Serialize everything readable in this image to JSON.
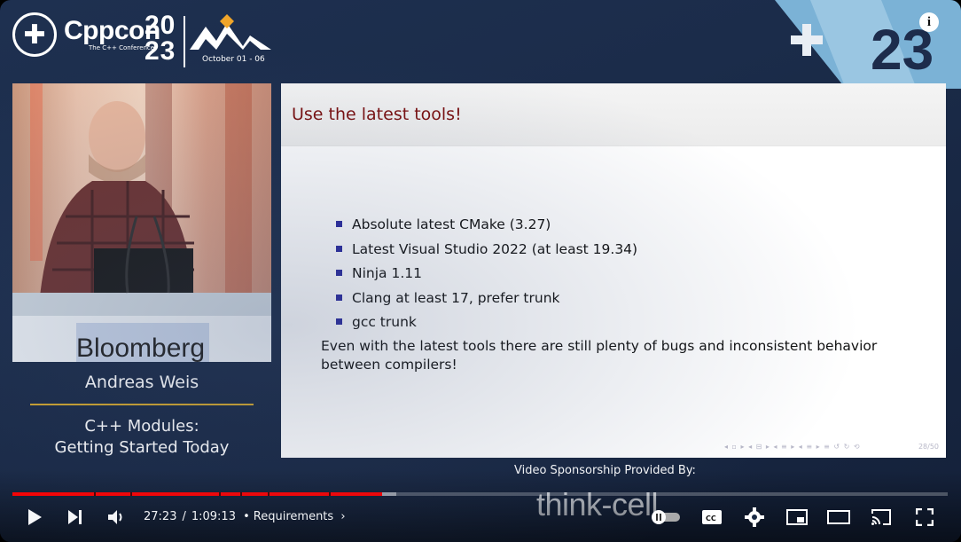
{
  "conference": {
    "logo_name": "Cppcon",
    "logo_sub": "The C++ Conference",
    "year_top": "20",
    "year_bottom": "23",
    "dates": "October 01 - 06",
    "corner_year": "23"
  },
  "speaker": {
    "name": "Andreas Weis",
    "talk_title_line1": "C++ Modules:",
    "talk_title_line2": "Getting Started Today",
    "podium_sponsor": "Bloomberg"
  },
  "slide": {
    "title": "Use the latest tools!",
    "bullets": [
      "Absolute latest CMake (3.27)",
      "Latest Visual Studio 2022 (at least 19.34)",
      "Ninja 1.11",
      "Clang at least 17, prefer trunk",
      "gcc trunk"
    ],
    "paragraph_line1": "Even with the latest tools there are still plenty of bugs and inconsistent behavior",
    "paragraph_line2": "between compilers!",
    "page": "28/50"
  },
  "sponsor": {
    "label": "Video Sponsorship Provided By:",
    "logo": "think-cell"
  },
  "player": {
    "current_time": "27:23",
    "duration": "1:09:13",
    "time_separator": "/",
    "chapter": "Requirements",
    "progress_played": 0.3955,
    "progress_loaded": 0.41,
    "colors": {
      "progress": "#ff0000",
      "title_red": "#7a0f0f",
      "bullet_blue": "#2a2a9e",
      "accent_gold": "#d4a72c"
    },
    "icons": [
      "play-icon",
      "next-icon",
      "volume-icon",
      "chevron-right-icon",
      "autoplay-toggle-icon",
      "captions-icon",
      "settings-icon",
      "miniplayer-icon",
      "theater-icon",
      "cast-icon",
      "fullscreen-icon",
      "info-icon"
    ]
  }
}
